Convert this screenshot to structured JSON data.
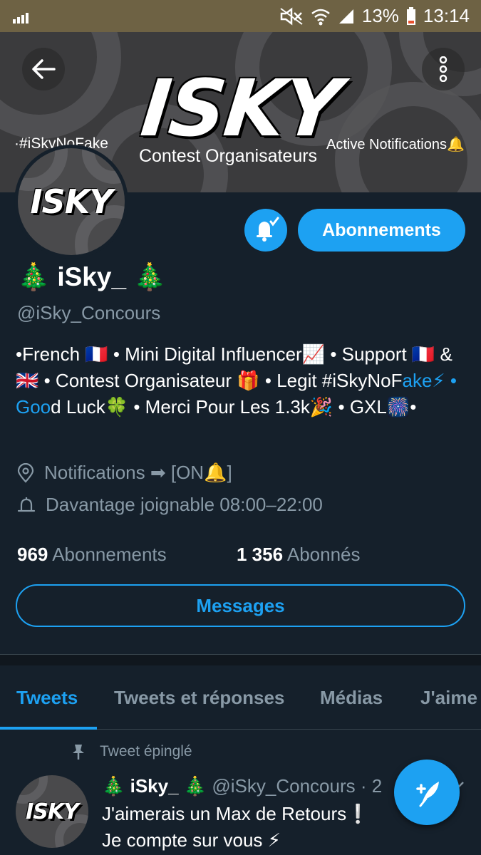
{
  "status_bar": {
    "battery": "13%",
    "time": "13:14"
  },
  "banner": {
    "logo_text": "ISKY",
    "subtitle": "Contest Organisateurs",
    "left_tag": "·#iSkyNoFake",
    "right_tag": "Active Notifications🔔"
  },
  "avatar": {
    "logo_text": "ISKY"
  },
  "actions": {
    "follow_label": "Abonnements",
    "messages_label": "Messages"
  },
  "profile": {
    "display_name": "🎄 iSky_ 🎄",
    "handle": "@iSky_Concours",
    "bio_part1": "•French 🇫🇷 • Mini Digital Influencer📈 • Support 🇫🇷 & 🇬🇧 • Contest Organisateur 🎁 • Legit #iSkyNoF",
    "bio_link1": "ake⚡",
    "bio_part2": " ",
    "bio_link2": "• Goo",
    "bio_part3": "d Luck🍀 • Merci Pour Les 1.3k🎉 • GXL🎆•",
    "location": "Notifications ➡ [ON🔔]",
    "hours": "Davantage joignable 08:00–22:00"
  },
  "stats": {
    "following_count": "969",
    "following_label": "Abonnements",
    "followers_count": "1 356",
    "followers_label": "Abonnés"
  },
  "tabs": [
    {
      "label": "Tweets"
    },
    {
      "label": "Tweets et réponses"
    },
    {
      "label": "Médias"
    },
    {
      "label": "J'aime"
    }
  ],
  "pinned_tweet": {
    "pinned_label": "Tweet épinglé",
    "author_name": "🎄 iSky_ 🎄",
    "author_handle": "@iSky_Concours",
    "time": "· 2",
    "line1": "J'aimerais un Max de Retours❕",
    "line2": "Je compte sur vous ⚡"
  },
  "colors": {
    "accent": "#1da1f2",
    "background": "#15202b",
    "secondary_text": "#8899a6",
    "status_bar": "#6e6244"
  }
}
